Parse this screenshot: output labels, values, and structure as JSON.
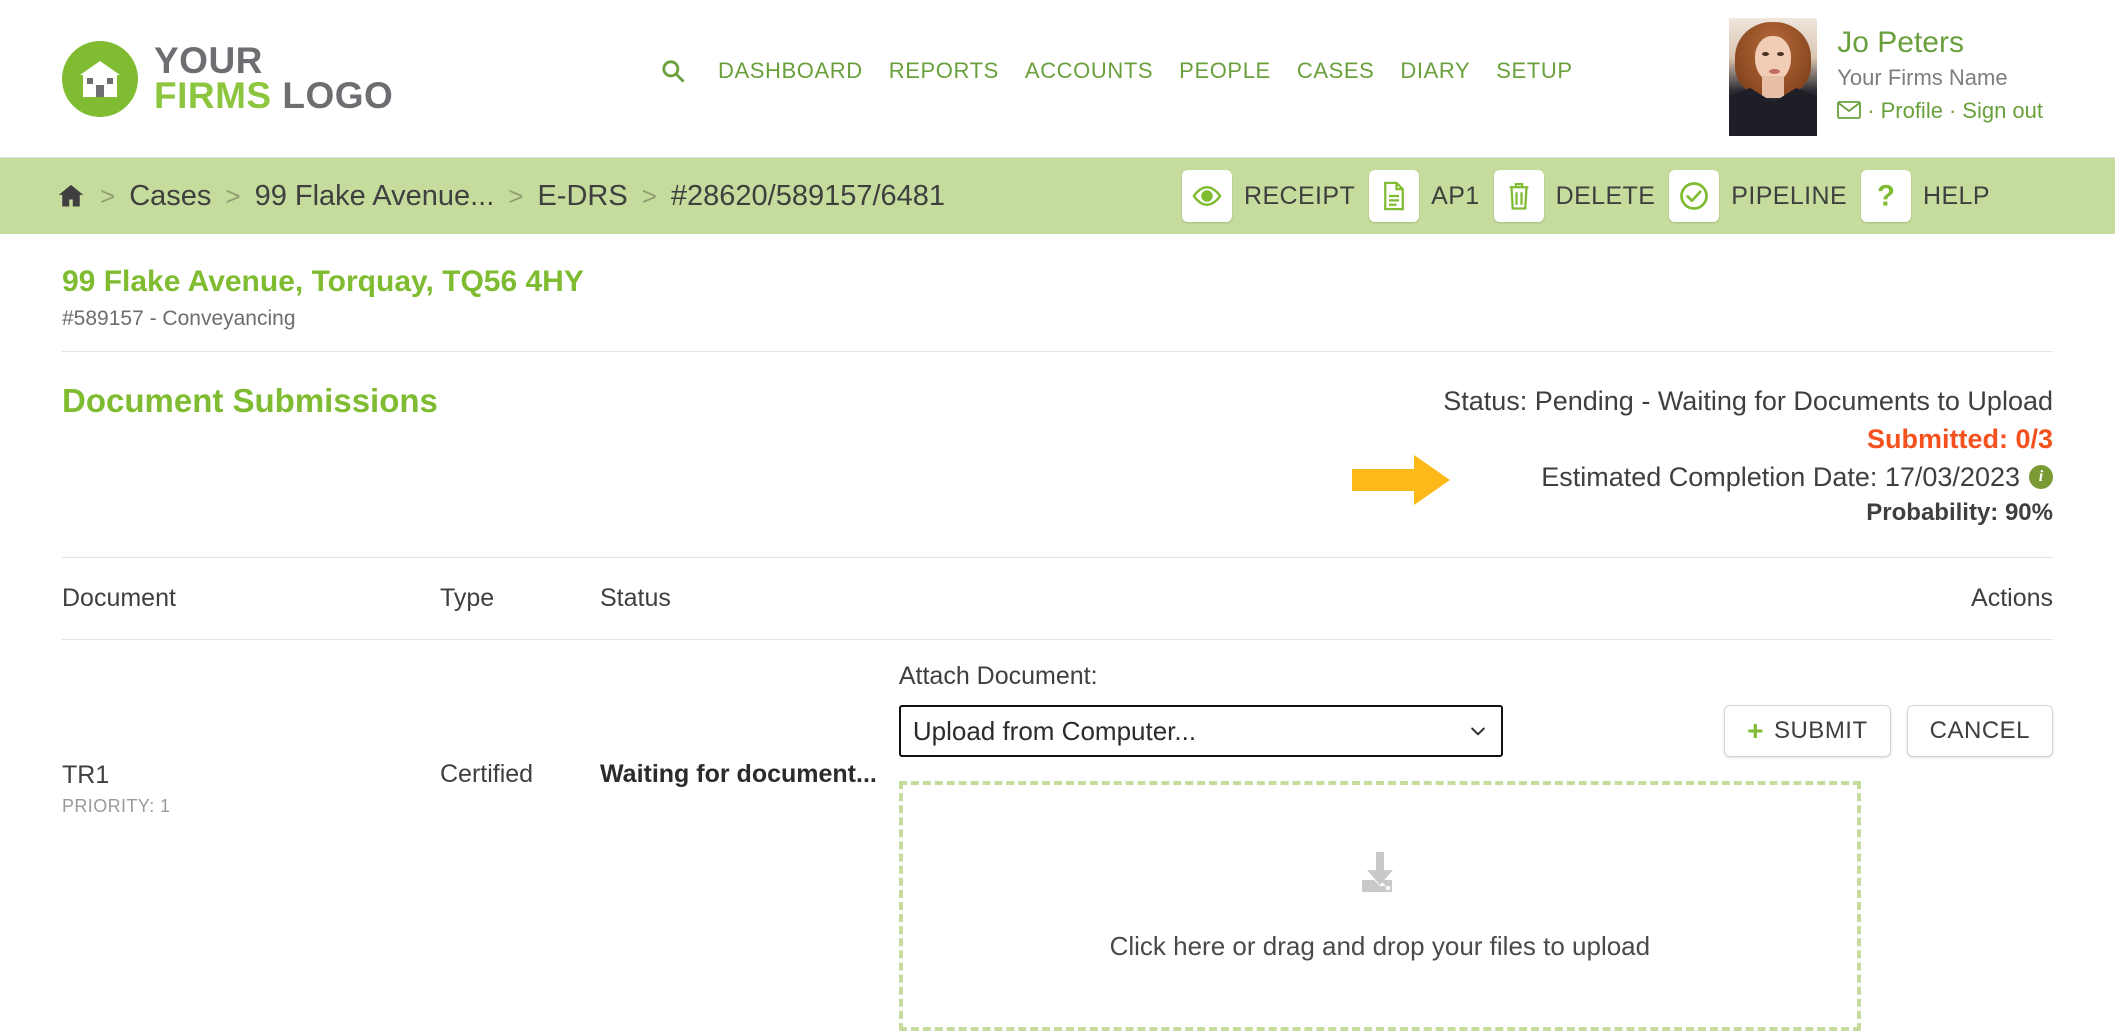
{
  "header": {
    "logo": {
      "line1": "YOUR",
      "firms": "FIRMS",
      "logo": "LOGO",
      "icon": "house-logo-icon"
    },
    "search_icon": "search-icon",
    "nav": [
      {
        "label": "DASHBOARD"
      },
      {
        "label": "REPORTS"
      },
      {
        "label": "ACCOUNTS"
      },
      {
        "label": "PEOPLE"
      },
      {
        "label": "CASES"
      },
      {
        "label": "DIARY"
      },
      {
        "label": "SETUP"
      }
    ],
    "user": {
      "name": "Jo Peters",
      "firm": "Your Firms Name",
      "mail_icon": "envelope-icon",
      "sep1": "·",
      "profile": "Profile",
      "sep2": "·",
      "signout": "Sign out"
    }
  },
  "breadcrumb": {
    "home_icon": "home-icon",
    "items": [
      {
        "label": "Cases"
      },
      {
        "label": "99 Flake Avenue..."
      },
      {
        "label": "E-DRS"
      },
      {
        "label": "#28620/589157/6481"
      }
    ],
    "separator": ">",
    "actions": [
      {
        "label": "RECEIPT",
        "icon": "eye-icon"
      },
      {
        "label": "AP1",
        "icon": "document-icon"
      },
      {
        "label": "DELETE",
        "icon": "trash-icon"
      },
      {
        "label": "PIPELINE",
        "icon": "check-circle-icon"
      },
      {
        "label": "HELP",
        "icon": "question-mark-icon"
      }
    ]
  },
  "case": {
    "title": "99 Flake Avenue, Torquay, TQ56 4HY",
    "subtitle": "#589157 - Conveyancing"
  },
  "submissions": {
    "title": "Document Submissions",
    "status": "Status: Pending - Waiting for Documents to Upload",
    "submitted": "Submitted: 0/3",
    "estimated_completion": "Estimated Completion Date: 17/03/2023",
    "info_icon": "info-icon",
    "probability": "Probability: 90%",
    "annotation_arrow": "yellow-arrow-annotation"
  },
  "table": {
    "columns": {
      "document": "Document",
      "type": "Type",
      "status": "Status",
      "actions": "Actions"
    },
    "rows": [
      {
        "document": "TR1",
        "priority": "PRIORITY: 1",
        "type": "Certified",
        "status": "Waiting for document..."
      }
    ]
  },
  "attach": {
    "label": "Attach Document:",
    "select_value": "Upload from Computer...",
    "select_options": [
      "Upload from Computer..."
    ],
    "chevron_icon": "chevron-down-icon",
    "submit_label": "SUBMIT",
    "submit_icon": "plus-icon",
    "cancel_label": "CANCEL",
    "dropzone_icon": "download-tray-icon",
    "dropzone_text": "Click here or drag and drop your files to upload"
  },
  "colors": {
    "brand_green": "#7fbc32",
    "nav_green": "#6aa03c",
    "bar_green": "#c6dc9c",
    "alert_orange": "#f4511e",
    "annotation_yellow": "#ffb819",
    "info_green": "#7a9a36"
  }
}
